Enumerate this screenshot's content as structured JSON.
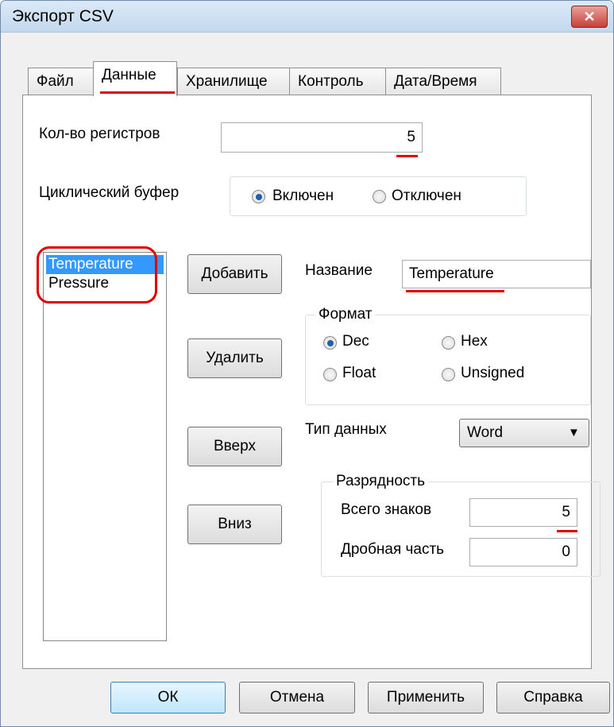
{
  "window": {
    "title": "Экспорт CSV",
    "close_symbol": "✕"
  },
  "tabs": [
    {
      "label": "Файл"
    },
    {
      "label": "Данные"
    },
    {
      "label": "Хранилище"
    },
    {
      "label": "Контроль"
    },
    {
      "label": "Дата/Время"
    }
  ],
  "data_tab": {
    "reg_count_label": "Кол-во регистров",
    "reg_count_value": "5",
    "cyclic_buffer_label": "Циклический буфер",
    "cyclic_on_label": "Включен",
    "cyclic_off_label": "Отключен",
    "registers": [
      "Temperature",
      "Pressure"
    ],
    "add_button": "Добавить",
    "delete_button": "Удалить",
    "up_button": "Вверх",
    "down_button": "Вниз",
    "name_label": "Название",
    "name_value": "Temperature",
    "format_group": "Формат",
    "format_dec": "Dec",
    "format_hex": "Hex",
    "format_float": "Float",
    "format_unsigned": "Unsigned",
    "datatype_label": "Тип данных",
    "datatype_value": "Word",
    "dropdown_symbol": "▼",
    "digits_group": "Разрядность",
    "total_digits_label": "Всего знаков",
    "total_digits_value": "5",
    "fraction_label": "Дробная часть",
    "fraction_value": "0"
  },
  "footer": {
    "ok_button": "ОК",
    "cancel_button": "Отмена",
    "apply_button": "Применить",
    "help_button": "Справка"
  },
  "colors": {
    "annotation_red": "#e00000",
    "selection_blue": "#3399ff"
  }
}
